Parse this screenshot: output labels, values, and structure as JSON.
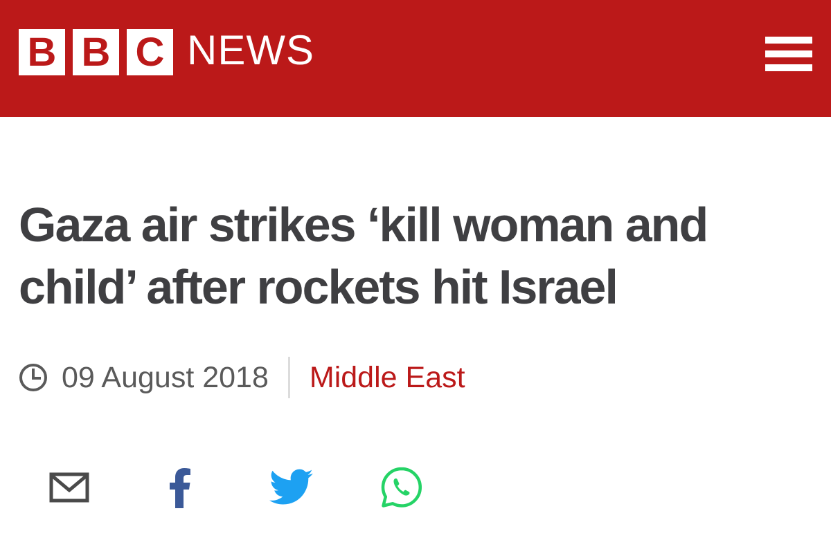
{
  "header": {
    "logo_letters": [
      "B",
      "B",
      "C"
    ],
    "logo_word": "NEWS",
    "brand_color": "#bb1919",
    "menu_icon": "hamburger-menu-icon"
  },
  "article": {
    "headline_line1": "Gaza air strikes ‘kill woman and",
    "headline_line2": "child’ after rockets hit Israel",
    "date": "09 August 2018",
    "section": "Middle East",
    "section_color": "#bb1919"
  },
  "share": {
    "icons": [
      "email-icon",
      "facebook-icon",
      "twitter-icon",
      "whatsapp-icon"
    ],
    "colors": {
      "email": "#4a4a4a",
      "facebook": "#3b5998",
      "twitter": "#1da1f2",
      "whatsapp": "#25d366"
    }
  }
}
